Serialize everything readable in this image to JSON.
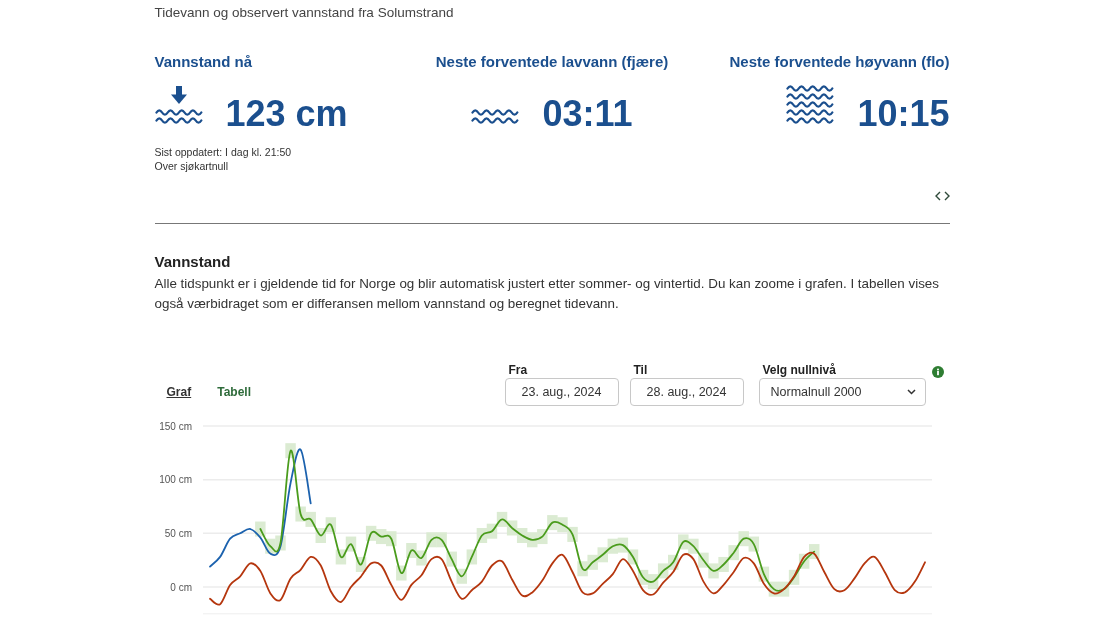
{
  "subtitle": "Tidevann og observert vannstand fra Solumstrand",
  "stats": [
    {
      "kind": "now",
      "heading": "Vannstand nå",
      "value": "123 cm",
      "notes": [
        "Sist oppdatert: I dag kl. 21:50",
        "Over sjøkartnull"
      ]
    },
    {
      "kind": "low",
      "heading": "Neste forventede lavvann (fjære)",
      "value": "03:11"
    },
    {
      "kind": "high",
      "heading": "Neste forventede høyvann (flo)",
      "value": "10:15"
    }
  ],
  "section": {
    "title": "Vannstand",
    "text": "Alle tidspunkt er i gjeldende tid for Norge og blir automatisk justert etter sommer- og vintertid. Du kan zoome i grafen. I tabellen vises også værbidraget som er differansen mellom vannstand og beregnet tidevann."
  },
  "view_tabs": [
    {
      "label": "Graf",
      "selected": true
    },
    {
      "label": "Tabell",
      "selected": false
    }
  ],
  "filters": [
    {
      "kind": "date",
      "label": "Fra",
      "value": "23. aug., 2024"
    },
    {
      "kind": "date",
      "label": "Til",
      "value": "28. aug., 2024"
    },
    {
      "kind": "select",
      "label": "Velg nullnivå",
      "value": "Normalnull 2000"
    }
  ],
  "chart_data": {
    "type": "line",
    "grid": true,
    "categories": [
      null,
      null,
      null,
      null,
      null,
      null,
      null,
      null,
      null,
      null,
      null,
      null,
      null,
      null,
      null,
      null,
      null,
      null,
      null,
      null,
      null,
      null,
      null,
      null,
      null,
      null,
      null,
      null,
      null,
      null,
      null,
      null,
      null,
      null,
      null,
      null,
      null,
      null,
      null,
      null,
      null,
      null,
      null,
      null,
      null,
      null,
      null,
      null,
      null,
      null,
      null,
      null,
      null,
      null,
      null,
      null,
      null,
      null,
      null,
      null,
      null,
      null,
      null,
      null,
      null,
      null,
      null,
      null,
      null,
      null,
      null,
      null
    ],
    "ylim": [
      -25,
      150
    ],
    "yticks": [
      {
        "value": 0,
        "label": "0 cm"
      },
      {
        "value": 50,
        "label": "50 cm"
      },
      {
        "value": 100,
        "label": "100 cm"
      },
      {
        "value": 150,
        "label": "150 cm"
      }
    ],
    "series": [
      {
        "color": "#1c62ae",
        "values": [
          19,
          28,
          45,
          50,
          54,
          46,
          31,
          38,
          97,
          128,
          78,
          null,
          null,
          null,
          null,
          null,
          null,
          null,
          null,
          null,
          null,
          null,
          null,
          null,
          null,
          null,
          null,
          null,
          null,
          null,
          null,
          null,
          null,
          null,
          null,
          null,
          null,
          null,
          null,
          null,
          null,
          null,
          null,
          null,
          null,
          null,
          null,
          null,
          null,
          null,
          null,
          null,
          null,
          null,
          null,
          null,
          null,
          null,
          null,
          null,
          null,
          null,
          null,
          null,
          null,
          null,
          null,
          null,
          null,
          null,
          null,
          null
        ]
      },
      {
        "color": "#4a9c1c",
        "values": [
          null,
          null,
          null,
          null,
          null,
          54,
          38,
          41,
          127,
          68,
          63,
          48,
          58,
          28,
          40,
          21,
          50,
          47,
          45,
          13,
          34,
          27,
          44,
          44,
          26,
          10,
          28,
          48,
          52,
          63,
          55,
          48,
          44,
          47,
          60,
          58,
          49,
          17,
          23,
          30,
          38,
          39,
          28,
          9,
          5,
          15,
          23,
          42,
          38,
          25,
          15,
          21,
          32,
          45,
          40,
          12,
          -2,
          -2,
          9,
          24,
          33,
          null,
          null,
          null,
          null,
          null,
          null,
          null,
          null,
          null,
          null,
          null
        ],
        "errors": [
          null,
          null,
          null,
          null,
          null,
          7,
          7,
          7,
          7,
          7,
          7,
          7,
          7,
          7,
          7,
          7,
          7,
          7,
          7,
          7,
          7,
          7,
          7,
          7,
          7,
          7,
          7,
          7,
          7,
          7,
          7,
          7,
          7,
          7,
          7,
          7,
          7,
          7,
          7,
          7,
          7,
          7,
          7,
          7,
          7,
          7,
          7,
          7,
          7,
          7,
          7,
          7,
          7,
          7,
          7,
          7,
          7,
          7,
          7,
          7,
          7,
          null,
          null,
          null,
          null,
          null,
          null,
          null,
          null,
          null,
          null,
          null
        ]
      },
      {
        "color": "#b5360e",
        "values": [
          -11,
          -16,
          2,
          10,
          22,
          15,
          -6,
          -12,
          8,
          16,
          28,
          20,
          -4,
          -14,
          0,
          10,
          22,
          20,
          2,
          -12,
          2,
          11,
          26,
          26,
          5,
          -11,
          -3,
          5,
          20,
          24,
          7,
          -8,
          -5,
          6,
          22,
          30,
          14,
          -5,
          -6,
          3,
          12,
          26,
          15,
          -3,
          -7,
          4,
          14,
          30,
          26,
          5,
          -6,
          2,
          14,
          27,
          22,
          3,
          -6,
          -2,
          10,
          28,
          31,
          14,
          -2,
          -3,
          8,
          22,
          28,
          14,
          -3,
          -5,
          5,
          23
        ]
      }
    ]
  }
}
